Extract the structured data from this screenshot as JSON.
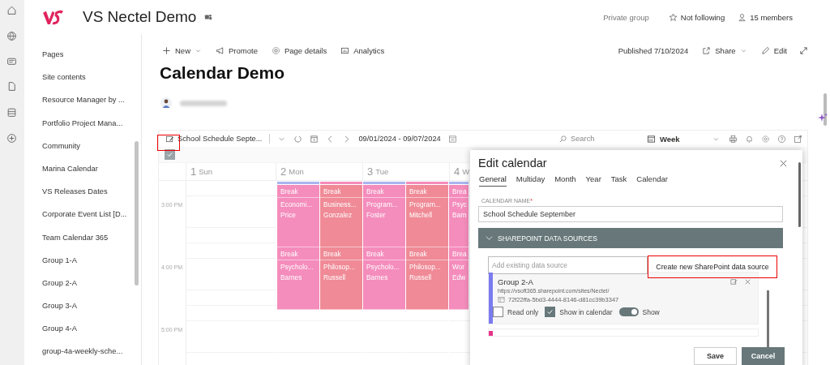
{
  "header": {
    "site_title": "VS Nectel Demo",
    "privacy": "Private group",
    "follow": "Not following",
    "members": "15 members"
  },
  "sidebar": {
    "items": [
      "Pages",
      "Site contents",
      "Resource Manager by ...",
      "Portfolio Project Mana...",
      "Community",
      "Marina Calendar",
      "VS Releases Dates",
      "Corporate Event List [D...",
      "Team Calendar 365",
      "Group 1-A",
      "Group 2-A",
      "Group 3-A",
      "Group 4-A",
      "group-4a-weekly-sche..."
    ]
  },
  "command_bar": {
    "new": "New",
    "promote": "Promote",
    "page_details": "Page details",
    "analytics": "Analytics",
    "published": "Published 7/10/2024",
    "share": "Share",
    "edit": "Edit"
  },
  "page_title": "Calendar Demo",
  "calendar": {
    "name": "School Schedule Septe...",
    "date_range": "09/01/2024 - 09/07/2024",
    "search_placeholder": "Search",
    "view": "Week",
    "all_checked": true,
    "days": [
      {
        "num": "1",
        "name": "Sun"
      },
      {
        "num": "2",
        "name": "Mon"
      },
      {
        "num": "3",
        "name": "Tue"
      },
      {
        "num": "4",
        "name": "W"
      }
    ],
    "times": [
      "3:00 PM",
      "4:00 PM",
      "5:00 PM"
    ],
    "columns": [
      {
        "color": "#f48cbc",
        "stripe": {
          "color": "#a9b4ef"
        },
        "events": [
          {
            "kind": "break",
            "lines": [
              "Break"
            ]
          },
          {
            "kind": "lesson",
            "lines": [
              "Economi...",
              "Price"
            ]
          },
          {
            "kind": "break",
            "lines": [
              "Break"
            ]
          },
          {
            "kind": "lesson",
            "lines": [
              "Psycholo...",
              "Barnes"
            ]
          }
        ]
      },
      {
        "color": "#ef8a96",
        "stripe": {
          "color": "#f48cbc"
        },
        "events": [
          {
            "kind": "break",
            "lines": [
              "Break"
            ]
          },
          {
            "kind": "lesson",
            "lines": [
              "Business...",
              "Gonzalez"
            ]
          },
          {
            "kind": "break",
            "lines": [
              "Break"
            ]
          },
          {
            "kind": "lesson",
            "lines": [
              "Philosop...",
              "Russell"
            ]
          }
        ]
      },
      {
        "color": "#f48cbc",
        "stripe": {
          "color": "#a9b4ef"
        },
        "events": [
          {
            "kind": "break",
            "lines": [
              "Break"
            ]
          },
          {
            "kind": "lesson",
            "lines": [
              "Program...",
              "Foster"
            ]
          },
          {
            "kind": "break",
            "lines": [
              "Break"
            ]
          },
          {
            "kind": "lesson",
            "lines": [
              "Psycholo...",
              "Barnes"
            ]
          }
        ]
      },
      {
        "color": "#ef8a96",
        "stripe": {
          "color": "#f48cbc"
        },
        "events": [
          {
            "kind": "break",
            "lines": [
              "Break"
            ]
          },
          {
            "kind": "lesson",
            "lines": [
              "Program...",
              "Mitchell"
            ]
          },
          {
            "kind": "break",
            "lines": [
              "Break"
            ]
          },
          {
            "kind": "lesson",
            "lines": [
              "Philosop...",
              "Russell"
            ]
          }
        ]
      },
      {
        "color": "#f48cbc",
        "stripe": {
          "color": "#a9b4ef"
        },
        "events": [
          {
            "kind": "break",
            "lines": [
              "Brea"
            ]
          },
          {
            "kind": "lesson",
            "lines": [
              "Psyc",
              "Barn"
            ]
          },
          {
            "kind": "break",
            "lines": [
              "Brea"
            ]
          },
          {
            "kind": "lesson",
            "lines": [
              "Wor",
              "Edw"
            ]
          }
        ]
      }
    ]
  },
  "dialog": {
    "title": "Edit calendar",
    "tabs": [
      {
        "label": "General",
        "selected": true
      },
      {
        "label": "Multiday",
        "selected": false
      },
      {
        "label": "Month",
        "selected": false
      },
      {
        "label": "Year",
        "selected": false
      },
      {
        "label": "Task",
        "selected": false
      },
      {
        "label": "Calendar",
        "selected": false
      }
    ],
    "name_label": "CALENDAR NAME",
    "name_required_mark": "*",
    "name_value": "School Schedule September",
    "section_title": "SHAREPOINT DATA SOURCES",
    "section_expanded": true,
    "add_placeholder": "Add existing data source",
    "create_button": "Create new SharePoint data source",
    "sources": [
      {
        "kind": "full",
        "color": "#7b7bf0",
        "name": "Group 2-A",
        "url": "https://vsoft365.sharepoint.com/sites/Nectel/",
        "list_id": "72f22ffa-5bd3-4444-8146-d81cc39b3347",
        "read_only_label": "Read only",
        "read_only": false,
        "show_in_calendar_label": "Show in calendar",
        "show_in_calendar": true,
        "show_label": "Show",
        "show": true
      },
      {
        "kind": "partial",
        "color": "#e8338a"
      }
    ],
    "save": "Save",
    "cancel": "Cancel"
  }
}
